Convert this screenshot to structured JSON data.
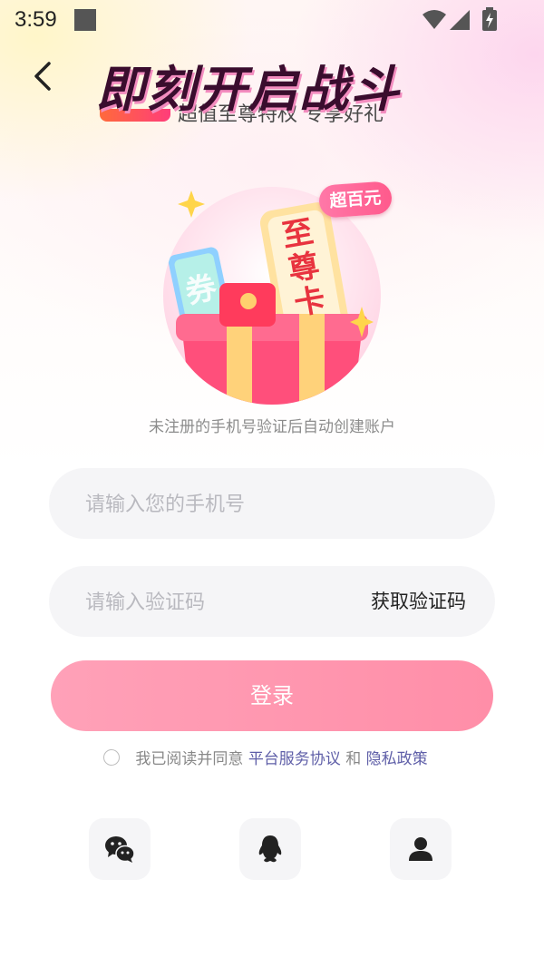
{
  "status_bar": {
    "time": "3:59"
  },
  "banner": {
    "title": "即刻开启战斗",
    "subtitle": "超值至尊特权 专享好礼"
  },
  "hero": {
    "badge": "超百元",
    "card_text": "至尊卡",
    "ticket_text": "券"
  },
  "form": {
    "register_hint": "未注册的手机号验证后自动创建账户",
    "phone_placeholder": "请输入您的手机号",
    "phone_value": "",
    "code_placeholder": "请输入验证码",
    "code_value": "",
    "get_code_label": "获取验证码",
    "login_label": "登录"
  },
  "agreement": {
    "prefix": "我已阅读并同意",
    "terms_label": "平台服务协议",
    "conjunction": "和",
    "privacy_label": "隐私政策",
    "checked": false
  },
  "social_login": [
    {
      "icon": "wechat-icon"
    },
    {
      "icon": "qq-icon"
    },
    {
      "icon": "account-icon"
    }
  ],
  "colors": {
    "primary_gradient_start": "#ffa1b8",
    "primary_gradient_end": "#ff8ea8",
    "link": "#5f5fa8",
    "title": "#3a0d2e",
    "field_bg": "#f5f5f7"
  }
}
